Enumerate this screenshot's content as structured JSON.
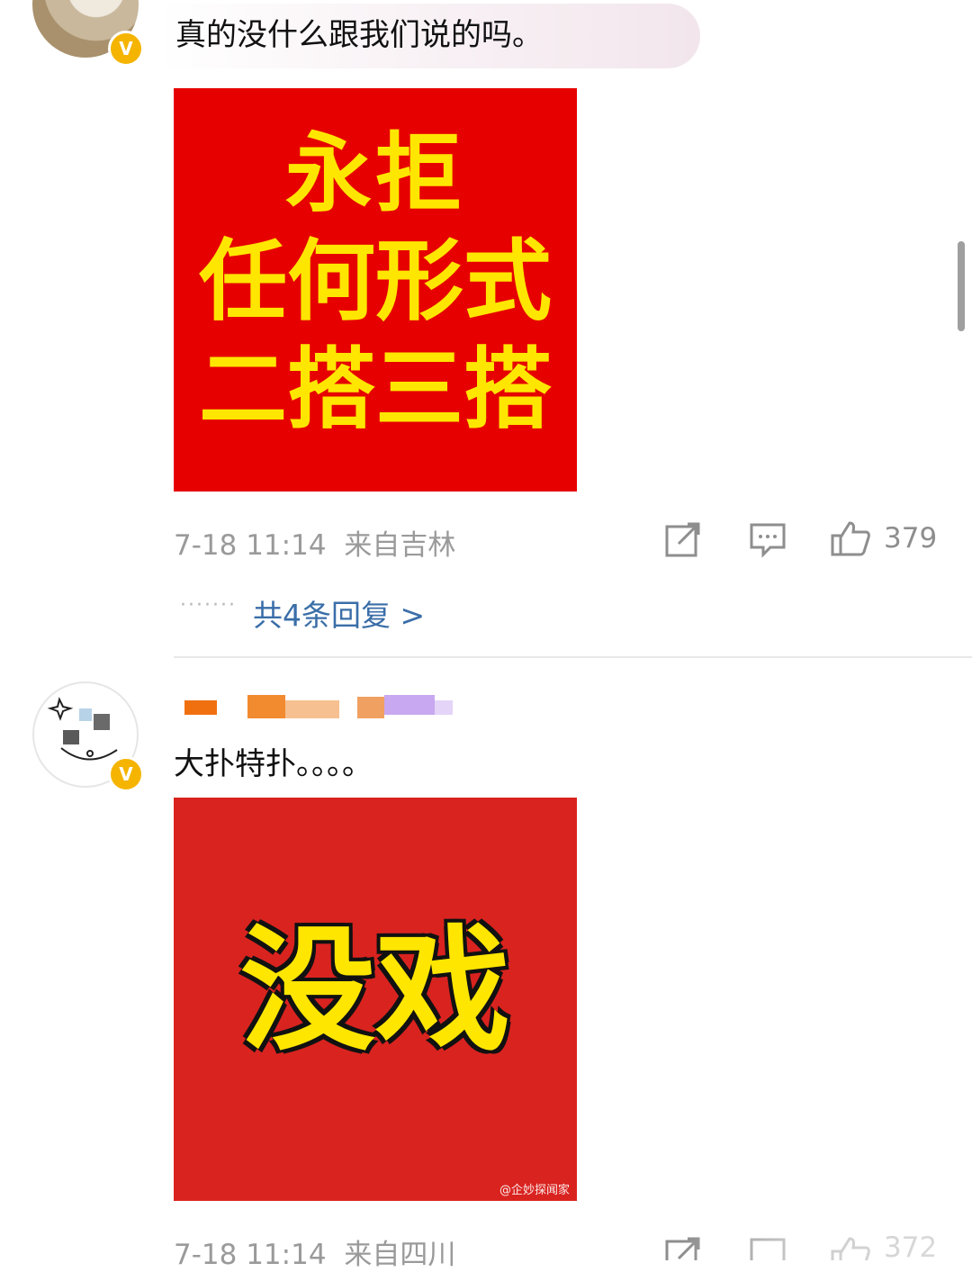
{
  "comments": [
    {
      "text": "真的没什么跟我们说的吗。",
      "poster_lines": [
        "永拒",
        "任何形式",
        "二搭三搭"
      ],
      "meta": {
        "time": "7-18 11:14",
        "location": "来自吉林"
      },
      "likes": "379",
      "replies_label": "共4条回复 >",
      "dots": "·······",
      "verified": "V"
    },
    {
      "text": "大扑特扑。。。。",
      "poster_text": "没戏",
      "watermark": "@企妙探闻家",
      "meta": {
        "time": "7-18 11:14",
        "location": "来自四川"
      },
      "likes": "372",
      "verified": "V"
    }
  ],
  "icons": [
    "share-icon",
    "comment-icon",
    "like-icon"
  ],
  "colors": {
    "accent_link": "#3a6ea8",
    "poster_red": "#e60000",
    "poster_yellow": "#ffe600",
    "verified": "#f5b400"
  }
}
